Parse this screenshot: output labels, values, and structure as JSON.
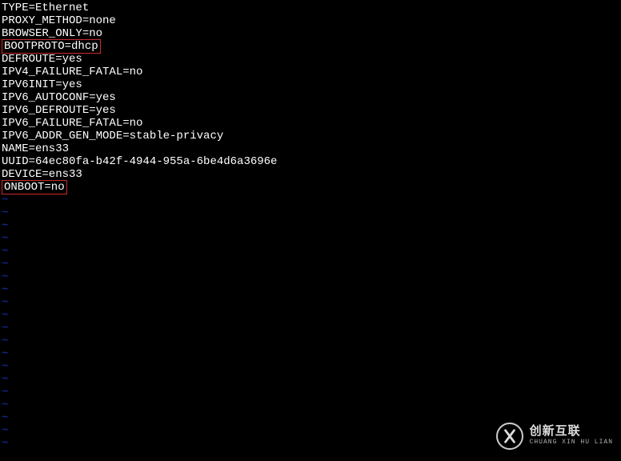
{
  "config_lines": [
    {
      "text": "TYPE=Ethernet",
      "highlight": false
    },
    {
      "text": "PROXY_METHOD=none",
      "highlight": false
    },
    {
      "text": "BROWSER_ONLY=no",
      "highlight": false
    },
    {
      "text": "BOOTPROTO=dhcp",
      "highlight": true
    },
    {
      "text": "DEFROUTE=yes",
      "highlight": false
    },
    {
      "text": "IPV4_FAILURE_FATAL=no",
      "highlight": false
    },
    {
      "text": "IPV6INIT=yes",
      "highlight": false
    },
    {
      "text": "IPV6_AUTOCONF=yes",
      "highlight": false
    },
    {
      "text": "IPV6_DEFROUTE=yes",
      "highlight": false
    },
    {
      "text": "IPV6_FAILURE_FATAL=no",
      "highlight": false
    },
    {
      "text": "IPV6_ADDR_GEN_MODE=stable-privacy",
      "highlight": false
    },
    {
      "text": "NAME=ens33",
      "highlight": false
    },
    {
      "text": "UUID=64ec80fa-b42f-4944-955a-6be4d6a3696e",
      "highlight": false
    },
    {
      "text": "DEVICE=ens33",
      "highlight": false
    },
    {
      "text": "ONBOOT=no",
      "highlight": true
    }
  ],
  "tilde_char": "~",
  "empty_line_count": 20,
  "watermark": {
    "cn": "创新互联",
    "en": "CHUANG XIN HU LIAN"
  }
}
